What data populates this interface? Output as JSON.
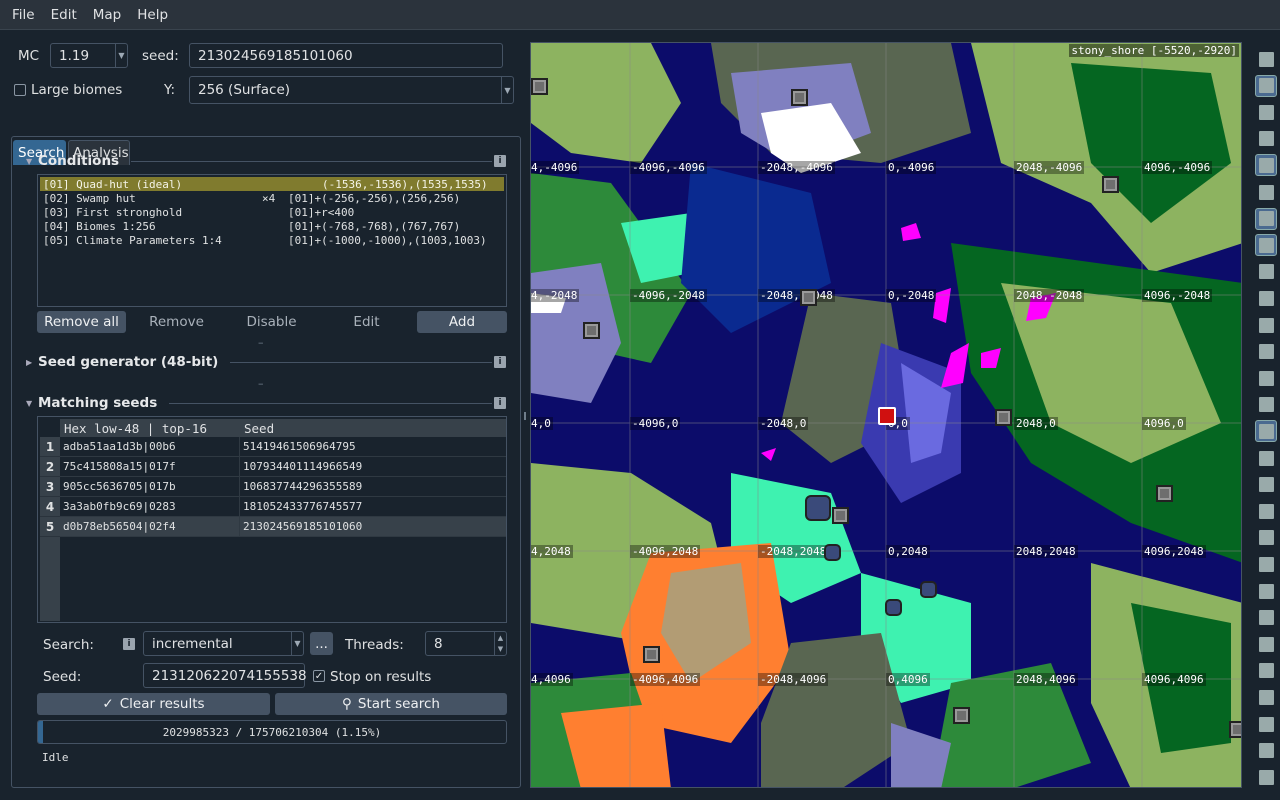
{
  "menu": [
    "File",
    "Edit",
    "Map",
    "Help"
  ],
  "mc": {
    "label": "MC",
    "version": "1.19"
  },
  "seed": {
    "label": "seed:",
    "value": "213024569185101060"
  },
  "large_biomes": {
    "label": "Large biomes",
    "checked": false
  },
  "y": {
    "label": "Y:",
    "value": "256 (Surface)"
  },
  "tabs": [
    {
      "label": "Search",
      "active": true
    },
    {
      "label": "Analysis",
      "active": false
    }
  ],
  "conditions": {
    "title": "Conditions",
    "items": [
      {
        "name": "[01] Quad-hut (ideal)",
        "mult": "",
        "area": "(-1536,-1536),(1535,1535)",
        "selected": true
      },
      {
        "name": "[02] Swamp hut",
        "mult": "×4",
        "area": "[01]+(-256,-256),(256,256)",
        "selected": false
      },
      {
        "name": "[03] First stronghold",
        "mult": "",
        "area": "[01]+r<400",
        "selected": false
      },
      {
        "name": "[04] Biomes 1:256",
        "mult": "",
        "area": "[01]+(-768,-768),(767,767)",
        "selected": false
      },
      {
        "name": "[05] Climate Parameters 1:4",
        "mult": "",
        "area": "[01]+(-1000,-1000),(1003,1003)",
        "selected": false
      }
    ],
    "buttons": {
      "remove_all": "Remove all",
      "remove": "Remove",
      "disable": "Disable",
      "edit": "Edit",
      "add": "Add"
    }
  },
  "seed_generator": {
    "title": "Seed generator (48-bit)"
  },
  "matching": {
    "title": "Matching seeds",
    "columns": [
      "Hex  low-48 | top-16",
      "Seed"
    ],
    "rows": [
      {
        "n": "1",
        "hex": "adba51aa1d3b|00b6",
        "seed": "51419461506964795"
      },
      {
        "n": "2",
        "hex": "75c415808a15|017f",
        "seed": "107934401114966549"
      },
      {
        "n": "3",
        "hex": "905cc5636705|017b",
        "seed": "106837744296355589"
      },
      {
        "n": "4",
        "hex": "3a3ab0fb9c69|0283",
        "seed": "181052433776745577"
      },
      {
        "n": "5",
        "hex": "d0b78eb56504|02f4",
        "seed": "213024569185101060"
      }
    ]
  },
  "search": {
    "label": "Search:",
    "mode": "incremental",
    "more": "...",
    "threads_label": "Threads:",
    "threads": "8"
  },
  "seedfield": {
    "label": "Seed:",
    "value": "213120622074155538",
    "stop_label": "Stop on results",
    "stop_checked": true
  },
  "actions": {
    "clear": "Clear results",
    "start": "Start search"
  },
  "progress": {
    "text": "2029985323 / 175706210304 (1.15%)",
    "fraction": 0.0115
  },
  "status": "Idle",
  "map": {
    "biome": "stony_shore [-5520,-2920]",
    "coords": [
      {
        "t": "4,-4096",
        "c": 0,
        "r": 0
      },
      {
        "t": "-4096,-4096",
        "c": 1,
        "r": 0
      },
      {
        "t": "-2048,-4096",
        "c": 2,
        "r": 0
      },
      {
        "t": "0,-4096",
        "c": 3,
        "r": 0
      },
      {
        "t": "2048,-4096",
        "c": 4,
        "r": 0
      },
      {
        "t": "4096,-4096",
        "c": 5,
        "r": 0
      },
      {
        "t": "4,-2048",
        "c": 0,
        "r": 1
      },
      {
        "t": "-4096,-2048",
        "c": 1,
        "r": 1
      },
      {
        "t": "-2048,-2048",
        "c": 2,
        "r": 1
      },
      {
        "t": "0,-2048",
        "c": 3,
        "r": 1
      },
      {
        "t": "2048,-2048",
        "c": 4,
        "r": 1
      },
      {
        "t": "4096,-2048",
        "c": 5,
        "r": 1
      },
      {
        "t": "4,0",
        "c": 0,
        "r": 2
      },
      {
        "t": "-4096,0",
        "c": 1,
        "r": 2
      },
      {
        "t": "-2048,0",
        "c": 2,
        "r": 2
      },
      {
        "t": "0,0",
        "c": 3,
        "r": 2
      },
      {
        "t": "2048,0",
        "c": 4,
        "r": 2
      },
      {
        "t": "4096,0",
        "c": 5,
        "r": 2
      },
      {
        "t": "4,2048",
        "c": 0,
        "r": 3
      },
      {
        "t": "-4096,2048",
        "c": 1,
        "r": 3
      },
      {
        "t": "-2048,2048",
        "c": 2,
        "r": 3
      },
      {
        "t": "0,2048",
        "c": 3,
        "r": 3
      },
      {
        "t": "2048,2048",
        "c": 4,
        "r": 3
      },
      {
        "t": "4096,2048",
        "c": 5,
        "r": 3
      },
      {
        "t": "4,4096",
        "c": 0,
        "r": 4
      },
      {
        "t": "-4096,4096",
        "c": 1,
        "r": 4
      },
      {
        "t": "-2048,4096",
        "c": 2,
        "r": 4
      },
      {
        "t": "0,4096",
        "c": 3,
        "r": 4
      },
      {
        "t": "2048,4096",
        "c": 4,
        "r": 4
      },
      {
        "t": "4096,4096",
        "c": 5,
        "r": 4
      }
    ]
  },
  "toolbar_icons": [
    "compass-icon",
    "biome-map-icon",
    "terrain-icon",
    "heightmap-icon",
    "grid-icon",
    "slime-icon",
    "village-icon",
    "hut-icon",
    "fortress-icon",
    "bastion-icon",
    "desert-pyramid-icon",
    "jungle-temple-icon",
    "igloo-icon",
    "outpost-icon",
    "monument-icon",
    "mansion-icon",
    "ruined-portal-icon",
    "shipwreck-icon",
    "ocean-ruin-icon",
    "treasure-icon",
    "mineshaft-icon",
    "ancient-city-icon",
    "trail-ruins-icon",
    "end-city-icon",
    "stronghold-icon",
    "spawn-icon",
    "gateway-icon",
    "player-icon"
  ],
  "colors": {
    "accent": "#346792",
    "selected": "#807b2e",
    "ocean": "#0c0c6a",
    "plains": "#8db360"
  }
}
